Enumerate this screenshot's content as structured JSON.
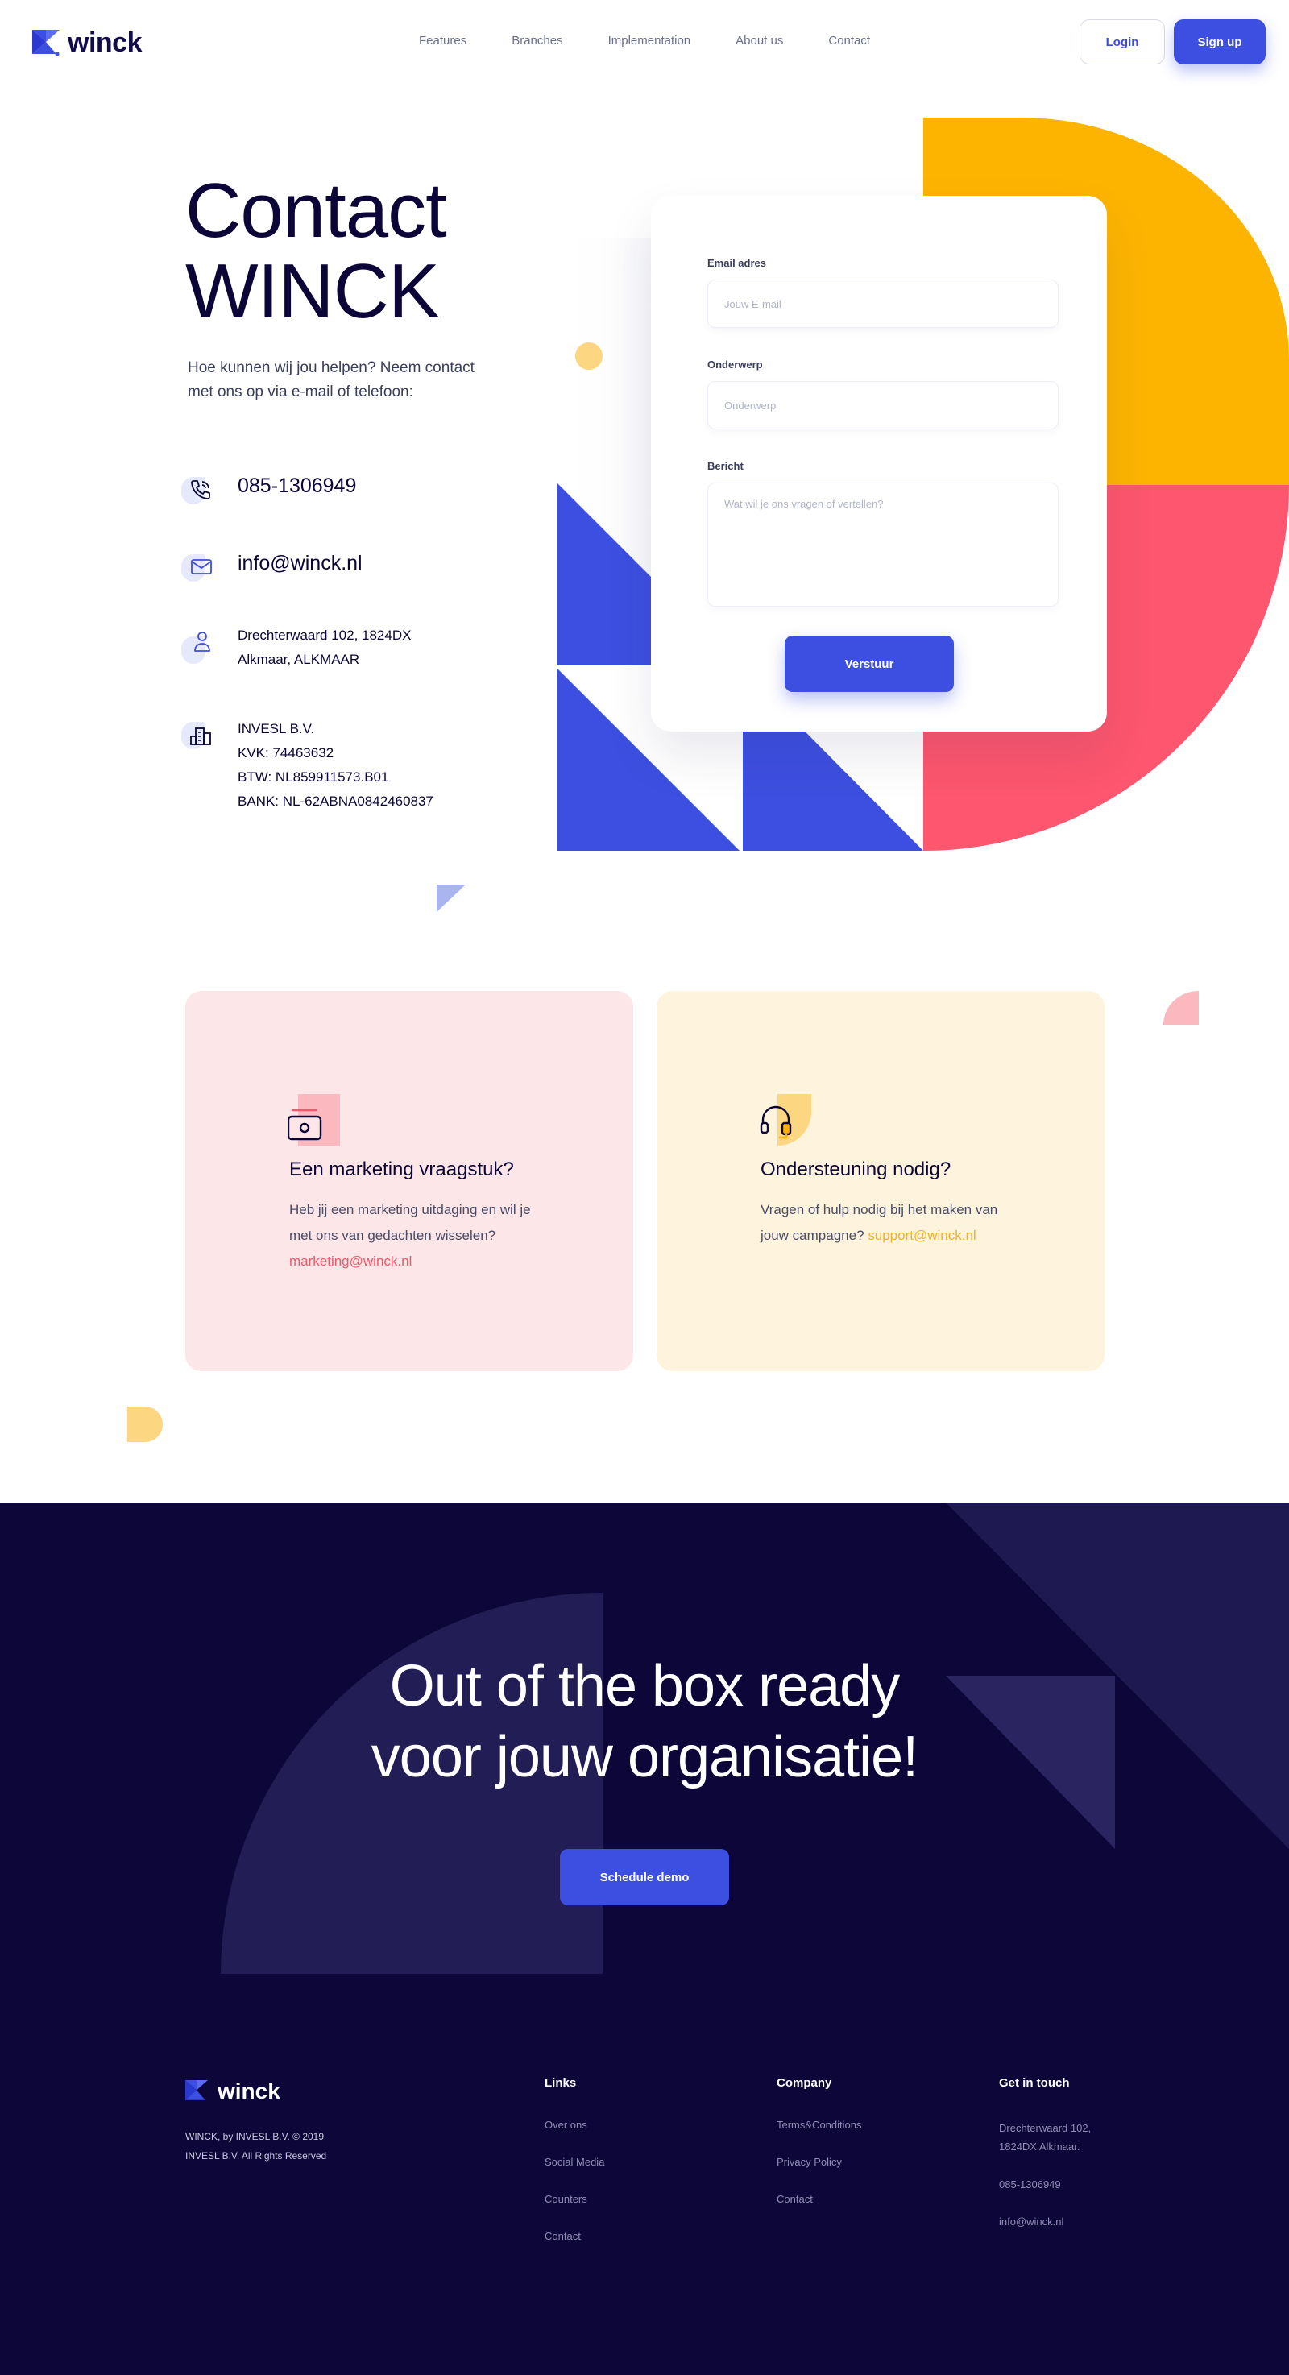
{
  "nav": {
    "brand": "winck",
    "links": [
      "Features",
      "Branches",
      "Implementation",
      "About us",
      "Contact"
    ],
    "login": "Login",
    "signup": "Sign up"
  },
  "hero": {
    "title_line1": "Contact",
    "title_line2": "WINCK",
    "subtitle": "Hoe kunnen wij jou helpen? Neem contact met ons op via e-mail of telefoon:",
    "phone": "085-1306949",
    "email": "info@winck.nl",
    "address_line1": "Drechterwaard 102, 1824DX",
    "address_line2": "Alkmaar, ALKMAAR",
    "company": [
      "INVESL B.V.",
      "KVK: 74463632",
      "BTW: NL859911573.B01",
      "BANK: NL-62ABNA0842460837"
    ]
  },
  "form": {
    "email_label": "Email adres",
    "email_placeholder": "Jouw E-mail",
    "subject_label": "Onderwerp",
    "subject_placeholder": "Onderwerp",
    "message_label": "Bericht",
    "message_placeholder": "Wat wil je ons vragen of vertellen?",
    "submit": "Verstuur"
  },
  "cards": {
    "marketing": {
      "title": "Een marketing vraagstuk?",
      "text": "Heb jij een marketing uitdaging en wil je met ons van gedachten wisselen?",
      "link": "marketing@winck.nl"
    },
    "support": {
      "title": "Ondersteuning nodig?",
      "text": "Vragen of hulp nodig bij het maken van jouw campagne?",
      "link": "support@winck.nl"
    }
  },
  "cta": {
    "title_line1": "Out of the box ready",
    "title_line2": "voor jouw organisatie!",
    "button": "Schedule demo"
  },
  "footer": {
    "brand": "winck",
    "copy_line1": "WINCK, by INVESL B.V. © 2019",
    "copy_line2": "INVESL B.V. All Rights Reserved",
    "links_title": "Links",
    "links": [
      "Over ons",
      "Social Media",
      "Counters",
      "Contact"
    ],
    "company_title": "Company",
    "company": [
      "Terms&Conditions",
      "Privacy Policy",
      "Contact"
    ],
    "touch_title": "Get in touch",
    "touch_address_line1": "Drechterwaard 102,",
    "touch_address_line2": "1824DX Alkmaar.",
    "touch_phone": "085-1306949",
    "touch_email": "info@winck.nl"
  },
  "colors": {
    "primary": "#3d4fe0",
    "navy": "#0d0639",
    "yellow": "#fdb400",
    "coral": "#fd566e",
    "pink_card": "#fde6e8",
    "yellow_card": "#fef3dc"
  }
}
